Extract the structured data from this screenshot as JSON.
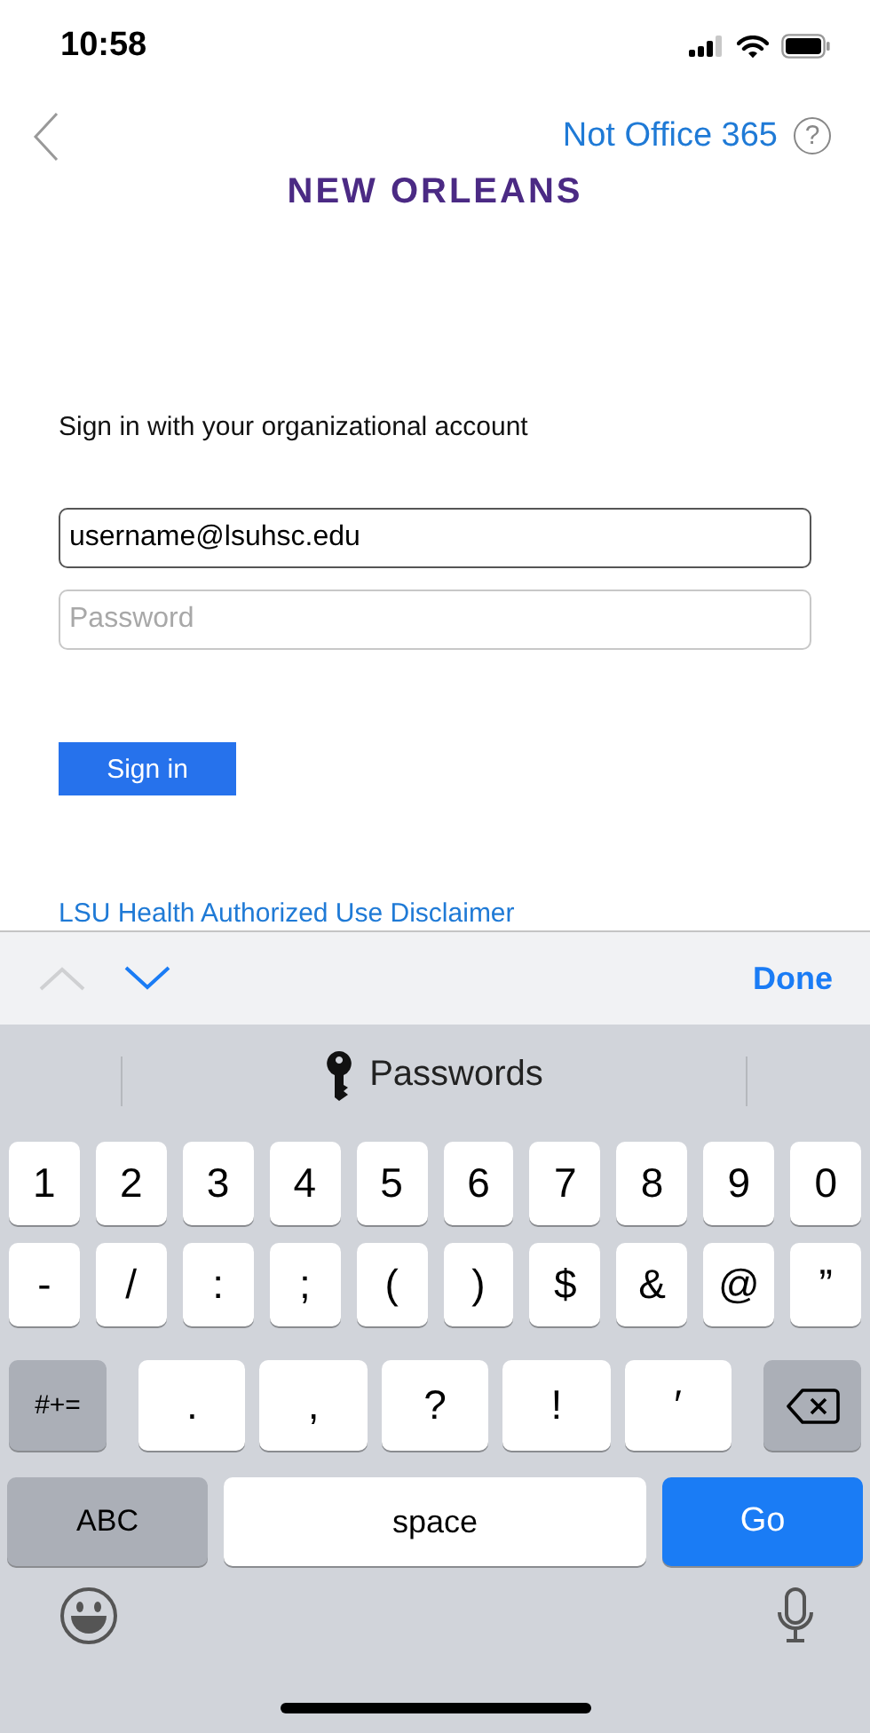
{
  "status_bar": {
    "time": "10:58"
  },
  "nav": {
    "link": "Not Office 365",
    "help": "?"
  },
  "logo": {
    "text": "NEW ORLEANS"
  },
  "form": {
    "heading": "Sign in with your organizational account",
    "fields": [
      {
        "kind": "text",
        "value": "username@lsuhsc.edu",
        "focused": true
      },
      {
        "kind": "password",
        "placeholder": "Password",
        "focused": false
      }
    ],
    "button": "Sign in",
    "link": "LSU Health Authorized Use Disclaimer"
  },
  "accessory_bar": {
    "arrows": [
      {
        "kind": "up",
        "disabled": true
      },
      {
        "kind": "down",
        "disabled": false
      }
    ],
    "done": "Done"
  },
  "suggestions": {
    "label": "Passwords"
  },
  "keyboard": {
    "digit_row": [
      {
        "kind": "char",
        "label": "1"
      },
      {
        "kind": "char",
        "label": "2"
      },
      {
        "kind": "char",
        "label": "3"
      },
      {
        "kind": "char",
        "label": "4"
      },
      {
        "kind": "char",
        "label": "5"
      },
      {
        "kind": "char",
        "label": "6"
      },
      {
        "kind": "char",
        "label": "7"
      },
      {
        "kind": "char",
        "label": "8"
      },
      {
        "kind": "char",
        "label": "9"
      },
      {
        "kind": "char",
        "label": "0"
      }
    ],
    "symbol_row": [
      {
        "kind": "char",
        "label": "-"
      },
      {
        "kind": "char",
        "label": "/"
      },
      {
        "kind": "char",
        "label": ":"
      },
      {
        "kind": "char",
        "label": ";"
      },
      {
        "kind": "char",
        "label": "("
      },
      {
        "kind": "char",
        "label": ")"
      },
      {
        "kind": "char",
        "label": "$"
      },
      {
        "kind": "char",
        "label": "&"
      },
      {
        "kind": "char",
        "label": "@"
      },
      {
        "kind": "char",
        "label": "”"
      }
    ],
    "punctuation_row": [
      {
        "kind": "mod",
        "label": "#+="
      },
      {
        "kind": "char",
        "label": "."
      },
      {
        "kind": "char",
        "label": ","
      },
      {
        "kind": "char",
        "label": "?"
      },
      {
        "kind": "char",
        "label": "!"
      },
      {
        "kind": "char",
        "label": "′"
      },
      {
        "kind": "delete"
      }
    ],
    "bottom_row": [
      {
        "kind": "wide",
        "label": "ABC"
      },
      {
        "kind": "space",
        "label": "space"
      },
      {
        "kind": "go",
        "label": "Go"
      }
    ]
  }
}
